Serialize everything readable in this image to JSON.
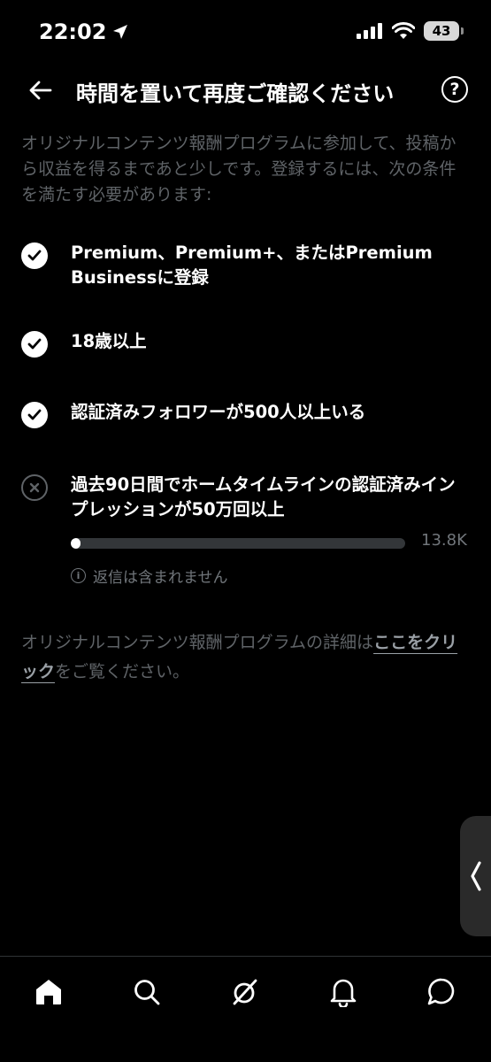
{
  "status_bar": {
    "time": "22:02",
    "battery": "43",
    "icons": [
      "location-arrow-icon",
      "cellular-signal-icon",
      "wifi-icon",
      "battery-icon"
    ]
  },
  "header": {
    "title": "時間を置いて再度ご確認ください",
    "back_icon": "arrow-left-icon",
    "help_label": "?"
  },
  "intro": "オリジナルコンテンツ報酬プログラムに参加して、投稿から収益を得るまであと少しです。登録するには、次の条件を満たす必要があります:",
  "requirements": [
    {
      "text": "Premium、Premium+、またはPremium Businessに登録",
      "status": "met"
    },
    {
      "text": "18歳以上",
      "status": "met"
    },
    {
      "text": "認証済みフォロワーが500人以上いる",
      "status": "met"
    },
    {
      "text": "過去90日間でホームタイムラインの認証済みインプレッションが50万回以上",
      "status": "not_met",
      "progress_value": "13.8K",
      "progress_fraction": 0.028,
      "note": "返信は含まれません",
      "note_icon": "info-icon"
    }
  ],
  "footer": {
    "text_before": "オリジナルコンテンツ報酬プログラムの詳細は",
    "link_text": "ここをクリック",
    "text_after": "をご覧ください。"
  },
  "tab_bar": {
    "tabs": [
      "home-icon",
      "search-icon",
      "grok-icon",
      "notifications-bell-icon",
      "messages-icon"
    ]
  },
  "colors": {
    "background": "#000000",
    "primary_text": "#ffffff",
    "secondary_text": "#5f6367",
    "muted_text": "#71767b",
    "progress_track": "#333639"
  }
}
